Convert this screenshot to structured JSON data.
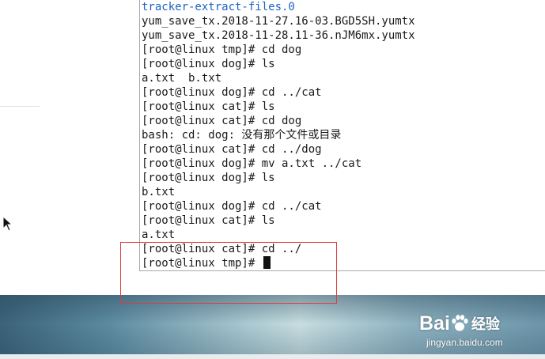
{
  "terminal": {
    "lines": [
      {
        "text": "tracker-extract-files.0",
        "color": "blue"
      },
      {
        "text": "yum_save_tx.2018-11-27.16-03.BGD5SH.yumtx"
      },
      {
        "text": "yum_save_tx.2018-11-28.11-36.nJM6mx.yumtx"
      },
      {
        "text": "[root@linux tmp]# cd dog"
      },
      {
        "text": "[root@linux dog]# ls"
      },
      {
        "text": "a.txt  b.txt"
      },
      {
        "text": "[root@linux dog]# cd ../cat"
      },
      {
        "text": "[root@linux cat]# ls"
      },
      {
        "text": "[root@linux cat]# cd dog"
      },
      {
        "text": "bash: cd: dog: 没有那个文件或目录"
      },
      {
        "text": "[root@linux cat]# cd ../dog"
      },
      {
        "text": "[root@linux dog]# mv a.txt ../cat"
      },
      {
        "text": "[root@linux dog]# ls"
      },
      {
        "text": "b.txt"
      },
      {
        "text": "[root@linux dog]# cd ../cat"
      },
      {
        "text": "[root@linux cat]# ls"
      },
      {
        "text": "a.txt"
      },
      {
        "text": "[root@linux cat]# cd ../"
      },
      {
        "text": "[root@linux tmp]# ",
        "cursor": true
      }
    ]
  },
  "colors": {
    "file_blue": "#1c62c1",
    "annotation_red": "#e03a3a"
  },
  "watermark": {
    "brand_left": "Bai",
    "brand_right": "经验",
    "url": "jingyan.baidu.com"
  },
  "icons": {
    "mouse_pointer": "arrow-cursor-icon",
    "watermark_paw": "baidu-paw-icon"
  }
}
